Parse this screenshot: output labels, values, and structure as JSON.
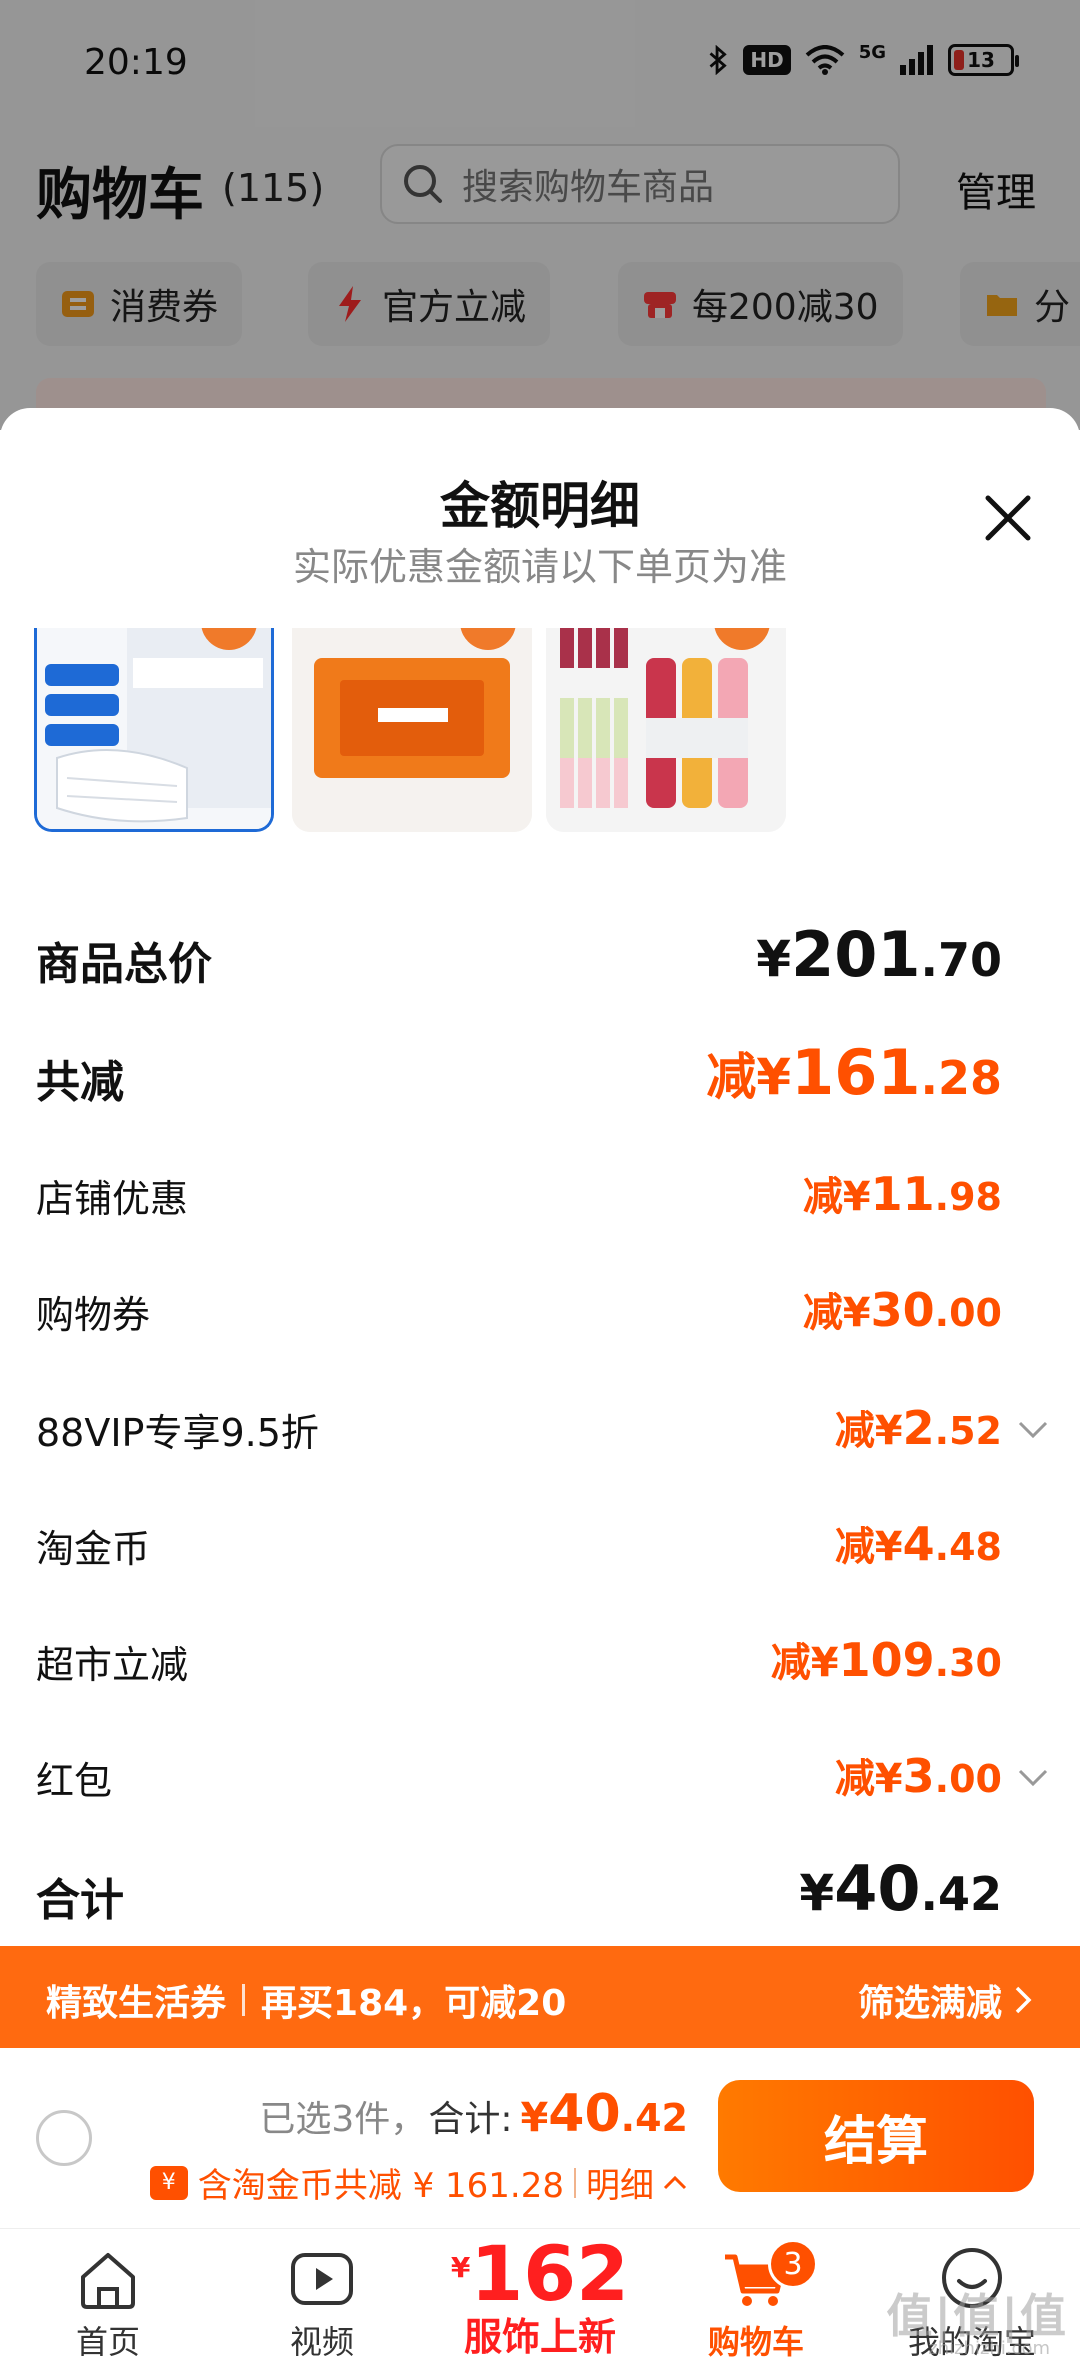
{
  "status_bar": {
    "time": "20:19",
    "network": "5G",
    "hd": "HD",
    "battery": "13"
  },
  "cart_header": {
    "title": "购物车",
    "count": "(115)",
    "search_placeholder": "搜索购物车商品",
    "manage": "管理"
  },
  "chips": [
    {
      "label": "消费券",
      "icon": "coupon-icon"
    },
    {
      "label": "官方立减",
      "icon": "lightning-icon"
    },
    {
      "label": "每200减30",
      "icon": "shop-icon"
    },
    {
      "label": "分",
      "icon": "folder-icon"
    }
  ],
  "sheet": {
    "title": "金额明细",
    "subtitle": "实际优惠金额请以下单页为准"
  },
  "rows": [
    {
      "label": "商品总价",
      "prefix": "¥",
      "int": "201",
      "dec": ".70",
      "style": "total"
    },
    {
      "label": "共减",
      "prefix": "减¥",
      "int": "161",
      "dec": ".28",
      "style": "discount-total"
    },
    {
      "label": "店铺优惠",
      "prefix": "减¥",
      "int": "11",
      "dec": ".98",
      "style": "discount"
    },
    {
      "label": "购物券",
      "prefix": "减¥",
      "int": "30",
      "dec": ".00",
      "style": "discount"
    },
    {
      "label": "88VIP专享9.5折",
      "prefix": "减¥",
      "int": "2",
      "dec": ".52",
      "style": "discount",
      "expandable": true
    },
    {
      "label": "淘金币",
      "prefix": "减¥",
      "int": "4",
      "dec": ".48",
      "style": "discount"
    },
    {
      "label": "超市立减",
      "prefix": "减¥",
      "int": "109",
      "dec": ".30",
      "style": "discount"
    },
    {
      "label": "红包",
      "prefix": "减¥",
      "int": "3",
      "dec": ".00",
      "style": "discount",
      "expandable": true
    },
    {
      "label": "合计",
      "prefix": "¥",
      "int": "40",
      "dec": ".42",
      "style": "sum"
    }
  ],
  "promo_bar": {
    "left_a": "精致生活券",
    "left_b": "再买184，可减20",
    "right": "筛选满减"
  },
  "checkout": {
    "selected": "已选3件，",
    "total_label": "合计:",
    "total_prefix": "¥",
    "total_int": "40",
    "total_dec": ".42",
    "coin_icon_text": "¥",
    "coin_text": "含淘金币共减 ¥ 161.28",
    "detail": "明细",
    "button": "结算"
  },
  "tabbar": {
    "home": "首页",
    "video": "视频",
    "promo_yen": "¥",
    "promo_num": "162",
    "promo_label": "服饰上新",
    "cart": "购物车",
    "cart_badge": "3",
    "mine": "我的淘宝"
  },
  "watermark": {
    "main": "值|值|值",
    "sub": "zhizhizhi.com"
  },
  "colors": {
    "accent": "#ff5000",
    "promo_bar": "#ff6a10",
    "promo_tab": "#ff1f1f"
  }
}
